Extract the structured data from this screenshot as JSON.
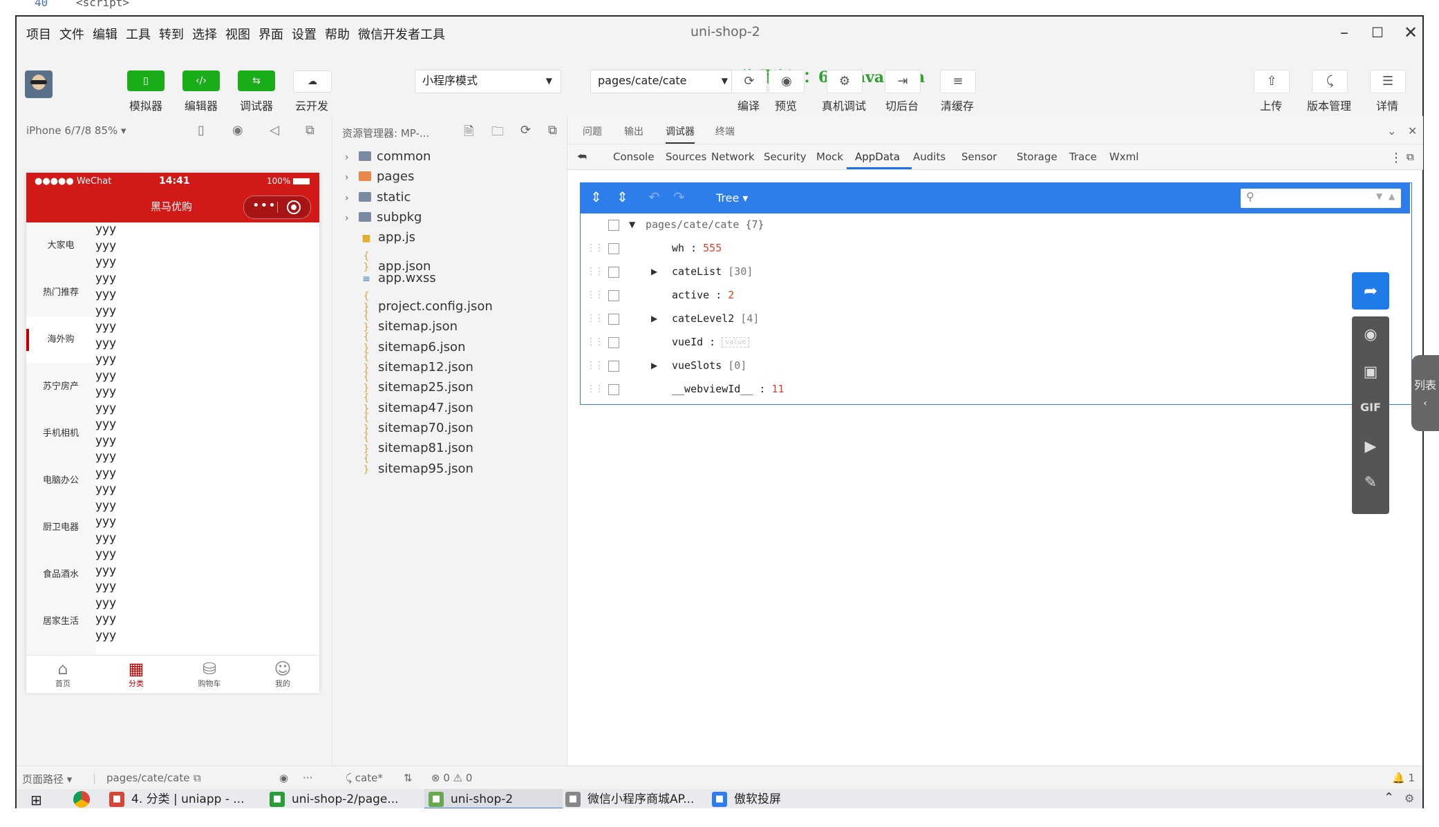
{
  "window": {
    "title": "uni-shop-2"
  },
  "menu": [
    "项目",
    "文件",
    "编辑",
    "工具",
    "转到",
    "选择",
    "视图",
    "界面",
    "设置",
    "帮助",
    "微信开发者工具"
  ],
  "toolbar": {
    "simulator": "模拟器",
    "editor": "编辑器",
    "debugger": "调试器",
    "cloud": "云开发",
    "mode_select": "小程序模式",
    "page_select": "pages/cate/cate",
    "compile": "编译",
    "preview": "预览",
    "real_debug": "真机调试",
    "background": "切后台",
    "clear_cache": "清缓存",
    "upload": "上传",
    "version": "版本管理",
    "details": "详情",
    "watermark": "海量资源：666java.com"
  },
  "simulator": {
    "device": "iPhone 6/7/8 85%",
    "status_left": "●●●●● WeChat",
    "time": "14:41",
    "battery": "100%",
    "page_title": "黑马优购",
    "categories": [
      "大家电",
      "热门推荐",
      "海外购",
      "苏宁房产",
      "手机相机",
      "电脑办公",
      "厨卫电器",
      "食品酒水",
      "居家生活"
    ],
    "active_category": 2,
    "item_text": "yyy",
    "tabs": [
      "首页",
      "分类",
      "购物车",
      "我的"
    ],
    "active_tab": 1
  },
  "explorer": {
    "title": "资源管理器: MP-...",
    "folders": [
      {
        "name": "common",
        "color": "#7a8aa0"
      },
      {
        "name": "pages",
        "color": "#e8874a"
      },
      {
        "name": "static",
        "color": "#7a8aa0"
      },
      {
        "name": "subpkg",
        "color": "#7a8aa0"
      }
    ],
    "files": [
      {
        "name": "app.js",
        "icon": "js"
      },
      {
        "name": "app.json",
        "icon": "{ }"
      },
      {
        "name": "app.wxss",
        "icon": "css"
      },
      {
        "name": "project.config.json",
        "icon": "{ }"
      },
      {
        "name": "sitemap.json",
        "icon": "{ }"
      },
      {
        "name": "sitemap6.json",
        "icon": "{ }"
      },
      {
        "name": "sitemap12.json",
        "icon": "{ }"
      },
      {
        "name": "sitemap25.json",
        "icon": "{ }"
      },
      {
        "name": "sitemap47.json",
        "icon": "{ }"
      },
      {
        "name": "sitemap70.json",
        "icon": "{ }"
      },
      {
        "name": "sitemap81.json",
        "icon": "{ }"
      },
      {
        "name": "sitemap95.json",
        "icon": "{ }"
      }
    ]
  },
  "debugger": {
    "panel_tabs": [
      "问题",
      "输出",
      "调试器",
      "终端"
    ],
    "active_panel_tab": 2,
    "devtools_tabs": [
      "Console",
      "Sources",
      "Network",
      "Security",
      "Mock",
      "AppData",
      "Audits",
      "Sensor",
      "Storage",
      "Trace",
      "Wxml"
    ],
    "active_devtools_tab": 5,
    "appdata": {
      "view_mode": "Tree",
      "root": "pages/cate/cate",
      "root_count": "{7}",
      "fields": [
        {
          "key": "wh",
          "value": "555",
          "kind": "num",
          "expandable": false
        },
        {
          "key": "cateList",
          "value": "[30]",
          "kind": "gray",
          "expandable": true
        },
        {
          "key": "active",
          "value": "2",
          "kind": "num",
          "expandable": false
        },
        {
          "key": "cateLevel2",
          "value": "[4]",
          "kind": "gray",
          "expandable": true
        },
        {
          "key": "vueId",
          "value": "value",
          "kind": "box",
          "expandable": false
        },
        {
          "key": "vueSlots",
          "value": "[0]",
          "kind": "gray",
          "expandable": true
        },
        {
          "key": "__webviewId__",
          "value": "11",
          "kind": "num",
          "expandable": false
        }
      ]
    },
    "side_list_label": "列表"
  },
  "statusbar": {
    "path_label": "页面路径",
    "path": "pages/cate/cate",
    "branch": "cate*",
    "errors": "0",
    "warnings": "0",
    "notifications": "1"
  },
  "taskbar": {
    "items": [
      {
        "label": "4. 分类 | uniapp - ...",
        "color": "#d44638"
      },
      {
        "label": "uni-shop-2/page...",
        "color": "#2a9d3a"
      },
      {
        "label": "uni-shop-2",
        "color": "#6aa84f"
      },
      {
        "label": "微信小程序商城AP...",
        "color": "#888888"
      },
      {
        "label": "傲软投屏",
        "color": "#2d7dea"
      }
    ],
    "active": 2
  }
}
